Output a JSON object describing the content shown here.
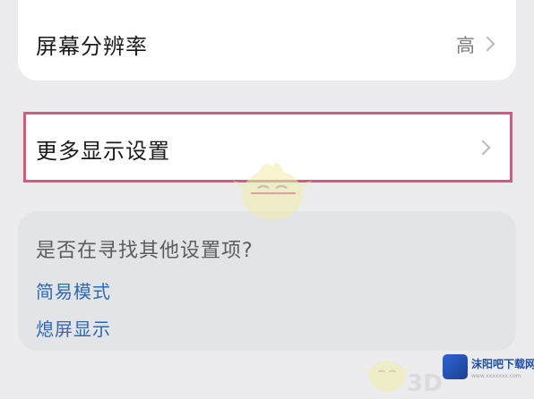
{
  "settings": {
    "resolution": {
      "label": "屏幕分辨率",
      "value": "高"
    },
    "more_display": {
      "label": "更多显示设置"
    },
    "search": {
      "title": "是否在寻找其他设置项?",
      "links": [
        "简易模式",
        "熄屏显示"
      ]
    }
  },
  "watermark": {
    "logo_text": "沫阳吧下载网",
    "logo_sub": "www.xxxxxxx.com",
    "mark_3d": "3D"
  },
  "colors": {
    "background": "#ececef",
    "card": "#ffffff",
    "highlight_border": "#d9577e",
    "link": "#2f68b4",
    "search_card": "#e3e4e8"
  },
  "icons": {
    "chevron": "chevron-right-icon",
    "mascot": "mascot-watermark-icon",
    "logo": "site-logo-icon"
  }
}
